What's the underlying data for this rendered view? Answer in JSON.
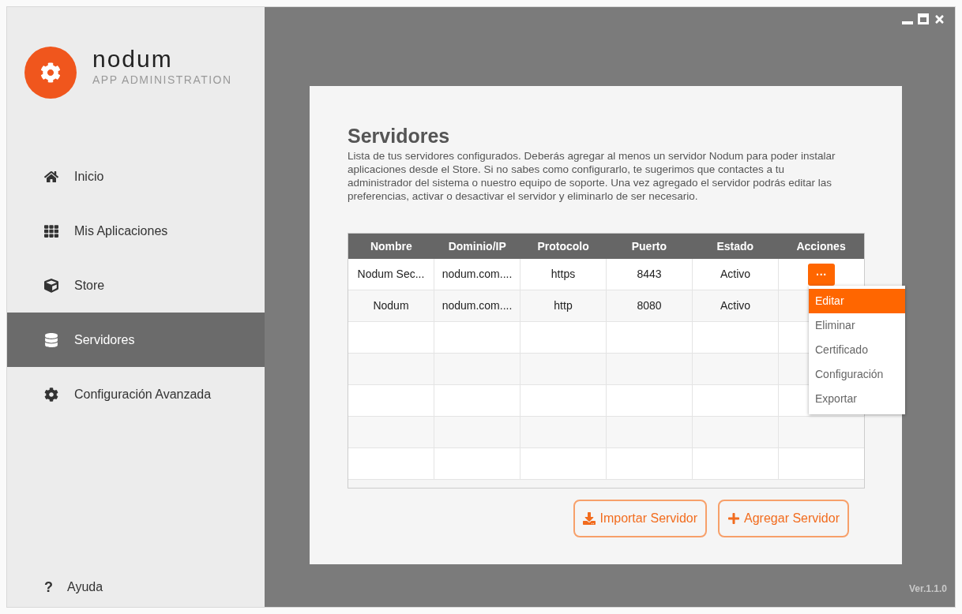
{
  "brand": {
    "name": "nodum",
    "subtitle": "APP ADMINISTRATION"
  },
  "nav": [
    {
      "label": "Inicio",
      "selected": false
    },
    {
      "label": "Mis Aplicaciones",
      "selected": false
    },
    {
      "label": "Store",
      "selected": false
    },
    {
      "label": "Servidores",
      "selected": true
    },
    {
      "label": "Configuración Avanzada",
      "selected": false
    }
  ],
  "help": {
    "label": "Ayuda",
    "icon": "?"
  },
  "page": {
    "title": "Servidores",
    "description": "Lista de tus servidores configurados. Deberás agregar al menos un servidor Nodum para poder instalar aplicaciones desde el Store. Si no sabes como configurarlo, te sugerimos que contactes a tu administrador del sistema o nuestro equipo de soporte. Una vez agregado el servidor podrás editar las preferencias, activar o desactivar el servidor y eliminarlo de ser necesario."
  },
  "table": {
    "columns": [
      "Nombre",
      "Dominio/IP",
      "Protocolo",
      "Puerto",
      "Estado",
      "Acciones"
    ],
    "rows": [
      {
        "cells": [
          "Nodum Sec...",
          "nodum.com....",
          "https",
          "8443",
          "Activo"
        ],
        "actions": {
          "label": "···",
          "expanded": true
        }
      },
      {
        "cells": [
          "Nodum",
          "nodum.com....",
          "http",
          "8080",
          "Activo"
        ]
      }
    ]
  },
  "actions_menu": [
    {
      "label": "Editar",
      "selected": true
    },
    {
      "label": "Eliminar",
      "selected": false
    },
    {
      "label": "Certificado",
      "selected": false
    },
    {
      "label": "Configuración",
      "selected": false
    },
    {
      "label": "Exportar",
      "selected": false
    }
  ],
  "buttons": [
    {
      "label": "Importar Servidor",
      "kind": "import"
    },
    {
      "label": "Agregar Servidor",
      "kind": "add"
    }
  ],
  "version": "Ver.1.1.0"
}
